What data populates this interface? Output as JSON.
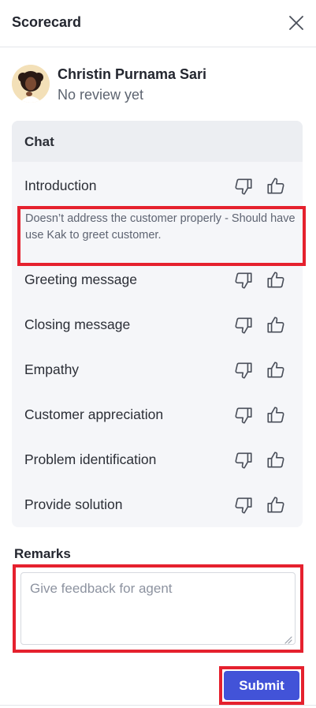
{
  "header": {
    "title": "Scorecard",
    "close_icon": "close-icon"
  },
  "profile": {
    "name": "Christin Purnama Sari",
    "status": "No review yet",
    "avatar_bg": "#f3e0b8"
  },
  "panel": {
    "title": "Chat",
    "criteria": [
      {
        "label": "Introduction"
      },
      {
        "label": "Greeting message"
      },
      {
        "label": "Closing message"
      },
      {
        "label": "Empathy"
      },
      {
        "label": "Customer appreciation"
      },
      {
        "label": "Problem identification"
      },
      {
        "label": "Provide solution"
      }
    ],
    "note": "Doesn’t address the customer properly - Should have use Kak to greet customer."
  },
  "remarks": {
    "label": "Remarks",
    "placeholder": "Give feedback for agent",
    "value": ""
  },
  "submit_label": "Submit",
  "colors": {
    "accent": "#4253d8",
    "highlight": "#e5212e",
    "panel_bg": "#f5f6f9",
    "panel_head_bg": "#eceef2"
  }
}
